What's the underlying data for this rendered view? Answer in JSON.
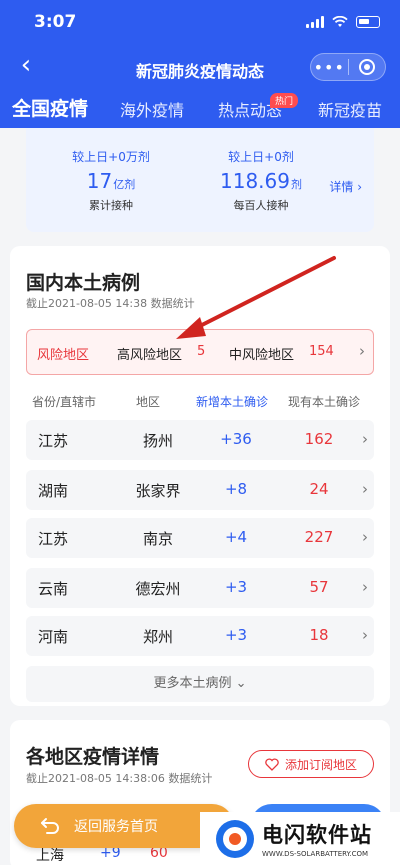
{
  "status": {
    "time": "3:07"
  },
  "nav": {
    "title": "新冠肺炎疫情动态",
    "more": "•••"
  },
  "tabs": [
    {
      "label": "全国疫情",
      "active": true
    },
    {
      "label": "海外疫情"
    },
    {
      "label": "热点动态",
      "badge": "热门"
    },
    {
      "label": "新冠疫苗"
    }
  ],
  "vaccine": {
    "left": {
      "delta": "较上日+0万剂",
      "value": "17",
      "unit": "亿剂",
      "label": "累计接种"
    },
    "right": {
      "delta": "较上日+0剂",
      "value": "118.69",
      "unit": "剂",
      "label": "每百人接种"
    },
    "more": "详情 ›"
  },
  "local": {
    "title": "国内本土病例",
    "subtitle": "截止2021-08-05 14:38 数据统计",
    "risk": {
      "label": "风险地区",
      "high_label": "高风险地区",
      "high_value": "5",
      "mid_label": "中风险地区",
      "mid_value": "154"
    },
    "headers": [
      "省份/直辖市",
      "地区",
      "新增本土确诊",
      "现有本土确诊"
    ],
    "rows": [
      {
        "province": "江苏",
        "city": "扬州",
        "new": "+36",
        "current": "162"
      },
      {
        "province": "湖南",
        "city": "张家界",
        "new": "+8",
        "current": "24"
      },
      {
        "province": "江苏",
        "city": "南京",
        "new": "+4",
        "current": "227"
      },
      {
        "province": "云南",
        "city": "德宏州",
        "new": "+3",
        "current": "57"
      },
      {
        "province": "河南",
        "city": "郑州",
        "new": "+3",
        "current": "18"
      }
    ],
    "more": "更多本土病例 ⌄"
  },
  "region": {
    "title": "各地区疫情详情",
    "subtitle": "截止2021-08-05 14:38:06 数据统计",
    "subscribe": "添加订阅地区",
    "peek": {
      "province": "上海",
      "new": "+9",
      "current": "60"
    }
  },
  "bottom": {
    "back_home": "返回服务首页"
  },
  "watermark": {
    "title": "电闪软件站",
    "url": "WWW.DS-SOLARBATTERY.COM"
  },
  "colors": {
    "primary": "#2e5cf0",
    "danger": "#e8363b",
    "home_button": "#f2a53a"
  }
}
